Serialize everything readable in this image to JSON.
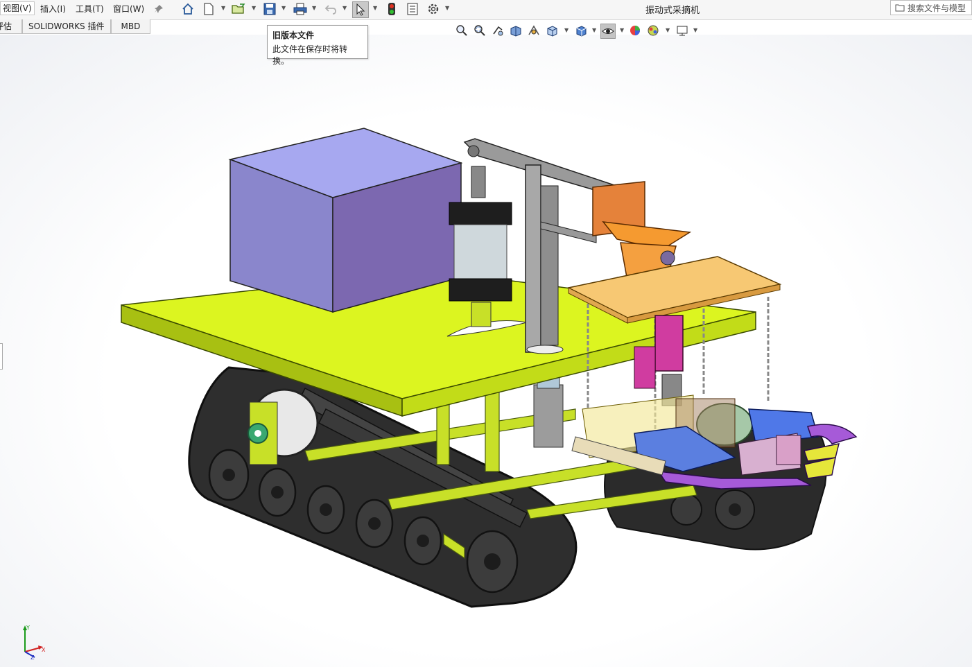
{
  "menubar": {
    "items": [
      {
        "label": "视图(V)"
      },
      {
        "label": "插入(I)"
      },
      {
        "label": "工具(T)"
      },
      {
        "label": "窗口(W)"
      }
    ]
  },
  "document": {
    "title": "振动式采摘机"
  },
  "search": {
    "placeholder": "搜索文件与模型"
  },
  "tabs": [
    {
      "label": "评估"
    },
    {
      "label": "SOLIDWORKS 插件"
    },
    {
      "label": "MBD"
    }
  ],
  "tooltip": {
    "title": "旧版本文件",
    "body": "此文件在保存时将转换。"
  },
  "toolbar_icons": [
    "home-icon",
    "new-document-icon",
    "open-folder-icon",
    "save-icon",
    "print-icon",
    "undo-icon",
    "select-arrow-icon",
    "rebuild-traffic-light-icon",
    "file-properties-icon",
    "options-gear-icon"
  ],
  "headsup_icons": [
    "zoom-to-fit-icon",
    "zoom-to-area-icon",
    "previous-view-icon",
    "section-view-icon",
    "dynamic-annotation-icon",
    "view-orientation-icon",
    "display-style-icon",
    "hide-show-items-icon",
    "edit-appearance-icon",
    "apply-scene-icon",
    "view-settings-icon"
  ],
  "colors": {
    "platform": "#d9f21f",
    "frame": "#c8e028",
    "box": "#8a86d0",
    "track": "#2a2a2a",
    "orange_part": "#f39a3a",
    "blue_part": "#5b7fe0",
    "magenta_part": "#d03ca0",
    "purple_part": "#b060d8",
    "tooltip_border": "#9a9a9a"
  },
  "triad_axes": {
    "y": "Y",
    "x": "X",
    "z": "Z"
  }
}
